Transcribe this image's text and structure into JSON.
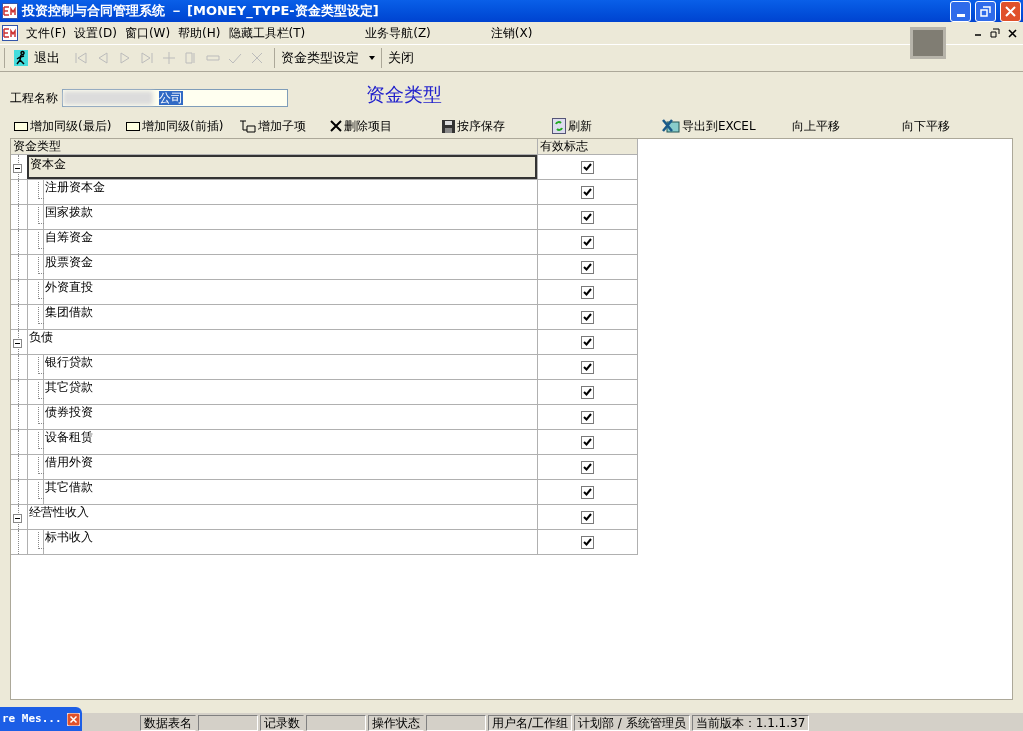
{
  "window": {
    "title": "投资控制与合同管理系统 － [MONEY_TYPE-资金类型设定]"
  },
  "menu": [
    "文件(F)",
    "设置(D)",
    "窗口(W)",
    "帮助(H)",
    "隐藏工具栏(T)",
    "业务导航(Z)",
    "注销(X)"
  ],
  "toolbar": {
    "exit": "退出",
    "nav_disabled": true,
    "dropdown": "资金类型设定",
    "close": "关闭"
  },
  "form": {
    "project_label": "工程名称",
    "project_value": "公司",
    "heading": "资金类型"
  },
  "actions": [
    {
      "kind": "rect",
      "label": "增加同级(最后)"
    },
    {
      "kind": "rect",
      "label": "增加同级(前插)"
    },
    {
      "kind": "child",
      "label": "增加子项"
    },
    {
      "kind": "delete",
      "label": "删除项目"
    },
    {
      "kind": "save",
      "label": "按序保存"
    },
    {
      "kind": "refresh",
      "label": "刷新"
    },
    {
      "kind": "excel",
      "label": "导出到EXCEL"
    },
    {
      "kind": "text",
      "label": "向上平移"
    },
    {
      "kind": "text",
      "label": "向下平移"
    }
  ],
  "table": {
    "columns": [
      "资金类型",
      "有效标志"
    ],
    "rows": [
      {
        "name": "资本金",
        "checked": true,
        "expanded": true,
        "selected": true,
        "children": [
          {
            "name": "注册资本金",
            "checked": true,
            "selected": false
          },
          {
            "name": "国家拨款",
            "checked": true,
            "selected": false
          },
          {
            "name": "自筹资金",
            "checked": true,
            "selected": false
          },
          {
            "name": "股票资金",
            "checked": true,
            "selected": false
          },
          {
            "name": "外资直投",
            "checked": true,
            "selected": false
          },
          {
            "name": "集团借款",
            "checked": true,
            "selected": false
          }
        ]
      },
      {
        "name": "负债",
        "checked": true,
        "expanded": true,
        "selected": false,
        "children": [
          {
            "name": "银行贷款",
            "checked": true,
            "selected": false
          },
          {
            "name": "其它贷款",
            "checked": true,
            "selected": false
          },
          {
            "name": "债券投资",
            "checked": true,
            "selected": false
          },
          {
            "name": "设备租赁",
            "checked": true,
            "selected": false
          },
          {
            "name": "借用外资",
            "checked": true,
            "selected": false
          },
          {
            "name": "其它借款",
            "checked": true,
            "selected": false
          }
        ]
      },
      {
        "name": "经营性收入",
        "checked": true,
        "expanded": true,
        "selected": false,
        "children": [
          {
            "name": "标书收入",
            "checked": true,
            "selected": false
          }
        ]
      }
    ]
  },
  "taskbar_item": "re Mes...",
  "status_bar": [
    {
      "label": "数据表名",
      "empty_panel_after": true
    },
    {
      "label": "记录数",
      "empty_panel_after": true
    },
    {
      "label": "操作状态",
      "empty_panel_after": true
    },
    {
      "label": "用户名/工作组",
      "empty_panel_after": false
    },
    {
      "label": "计划部 / 系统管理员",
      "empty_panel_after": false
    },
    {
      "label": "当前版本：1.1.1.37",
      "empty_panel_after": false
    }
  ]
}
